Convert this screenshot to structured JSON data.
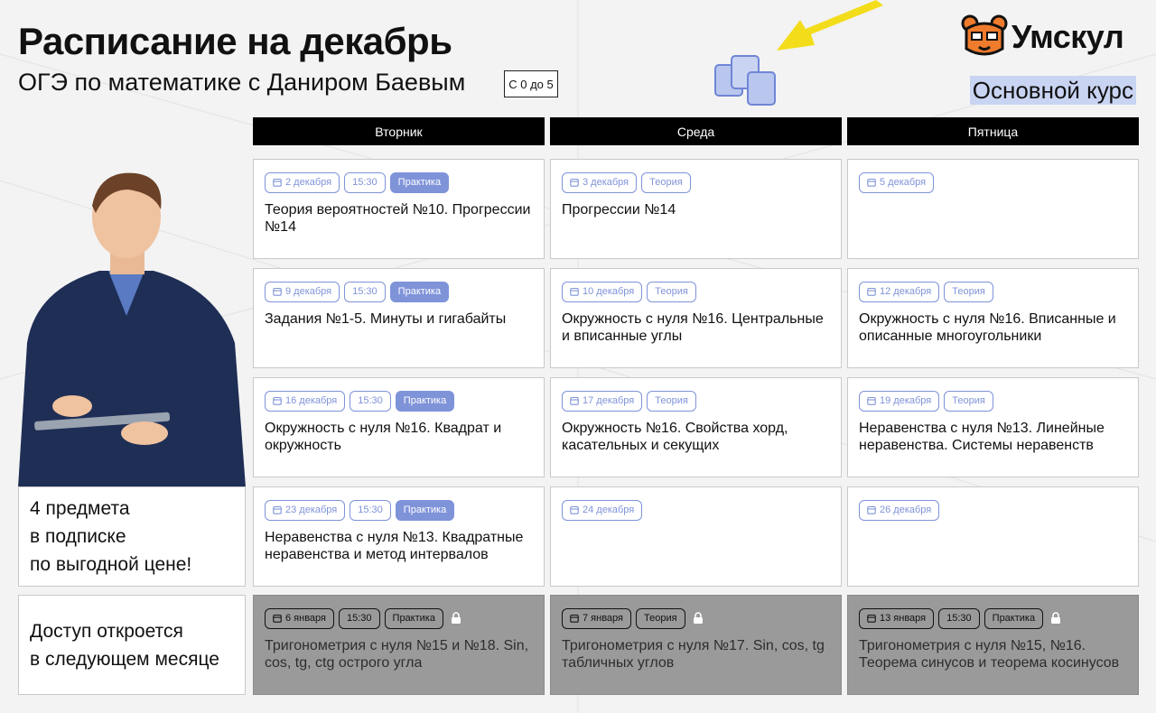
{
  "header": {
    "title": "Расписание на декабрь",
    "subtitle": "ОГЭ по математике с Даниром Баевым",
    "grade_badge": "С 0 до 5",
    "brand": "Умскул",
    "course": "Основной курс"
  },
  "days": [
    "Вторник",
    "Среда",
    "Пятница"
  ],
  "rows": [
    [
      {
        "date": "2 декабря",
        "time": "15:30",
        "type": "Практика",
        "text": "Теория вероятностей №10. Прогрессии №14"
      },
      {
        "date": "3 декабря",
        "type": "Теория",
        "text": "Прогрессии №14"
      },
      {
        "date": "5 декабря",
        "text": ""
      }
    ],
    [
      {
        "date": "9 декабря",
        "time": "15:30",
        "type": "Практика",
        "text": "Задания №1-5. Минуты и гигабайты"
      },
      {
        "date": "10 декабря",
        "type": "Теория",
        "text": "Окружность с нуля №16. Центральные и вписанные углы"
      },
      {
        "date": "12 декабря",
        "type": "Теория",
        "text": "Окружность с нуля №16. Вписанные и описанные многоугольники"
      }
    ],
    [
      {
        "date": "16 декабря",
        "time": "15:30",
        "type": "Практика",
        "text": "Окружность с нуля №16. Квадрат и окружность"
      },
      {
        "date": "17 декабря",
        "type": "Теория",
        "text": "Окружность №16. Свойства хорд, касательных и секущих"
      },
      {
        "date": "19 декабря",
        "type": "Теория",
        "text": "Неравенства с нуля №13. Линейные неравенства. Системы неравенств"
      }
    ],
    [
      {
        "date": "23 декабря",
        "time": "15:30",
        "type": "Практика",
        "text": "Неравенства с нуля №13. Квадратные неравенства и метод интервалов"
      },
      {
        "date": "24 декабря",
        "text": ""
      },
      {
        "date": "26 декабря",
        "text": ""
      }
    ],
    [
      {
        "date": "6 января",
        "time": "15:30",
        "type": "Практика",
        "text": "Тригонометрия с нуля №15 и №18. Sin, cos, tg, ctg острого угла"
      },
      {
        "date": "7 января",
        "type": "Теория",
        "text": "Тригонометрия с нуля №17. Sin, cos, tg табличных углов"
      },
      {
        "date": "13 января",
        "time": "15:30",
        "type": "Практика",
        "text": "Тригонометрия с нуля №15, №16. Теорема синусов и теорема косинусов"
      }
    ]
  ],
  "side": {
    "promo": [
      "4 предмета",
      "в подписке",
      "по выгодной цене!"
    ],
    "access": [
      "Доступ откроется",
      "в следующем месяце"
    ]
  },
  "colors": {
    "accent": "#7f93d9",
    "brand": "#ef7b2c",
    "highlight": "#c9d4f2",
    "arrow": "#f3dd1b"
  },
  "icons": {
    "date": "calendar-icon",
    "locked": "lock-icon",
    "logo": "bear-logo-icon"
  }
}
